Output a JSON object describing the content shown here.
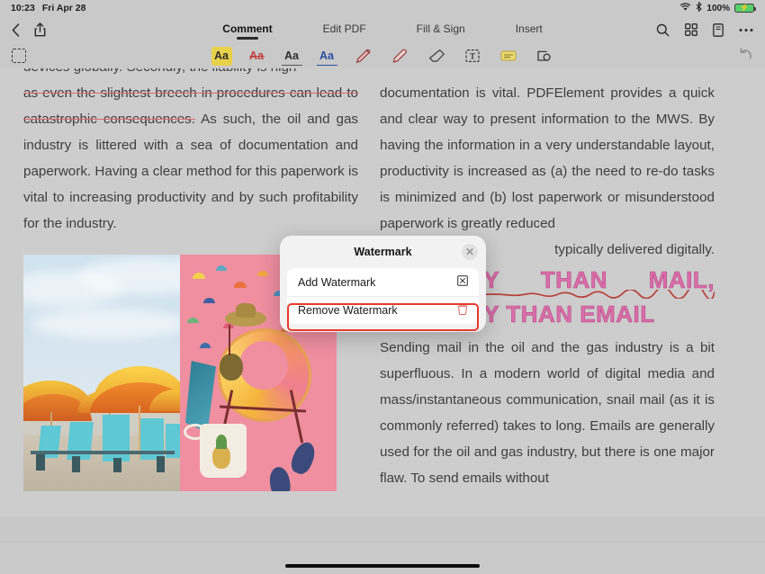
{
  "statusbar": {
    "time": "10:23",
    "date": "Fri Apr 28",
    "wifi_icon": "wifi-icon",
    "bluetooth_icon": "bluetooth-icon",
    "battery_percent": "100%",
    "battery_icon": "battery-charging-icon"
  },
  "navbar": {
    "back_icon": "chevron-left-icon",
    "share_icon": "share-icon",
    "tabs": [
      {
        "label": "Comment",
        "active": true
      },
      {
        "label": "Edit PDF",
        "active": false
      },
      {
        "label": "Fill & Sign",
        "active": false
      },
      {
        "label": "Insert",
        "active": false
      }
    ],
    "search_icon": "search-icon",
    "grid_icon": "grid-icon",
    "pages_icon": "page-thumbnail-icon",
    "more_icon": "more-ellipsis-icon"
  },
  "toolbar": {
    "select_tool": "marquee-select-icon",
    "tools": [
      {
        "name": "highlight-tool",
        "label": "Aa",
        "style": "hl-active"
      },
      {
        "name": "strikethrough-tool",
        "label": "Aa",
        "style": "strike"
      },
      {
        "name": "underline-tool",
        "label": "Aa",
        "style": "uline"
      },
      {
        "name": "squiggly-underline-tool",
        "label": "Aa",
        "style": "squig"
      },
      {
        "name": "pen-tool",
        "label": "✎",
        "style": "pen"
      },
      {
        "name": "marker-tool",
        "label": "✎",
        "style": "marker"
      },
      {
        "name": "eraser-tool",
        "label": "◇",
        "style": "eraser"
      },
      {
        "name": "text-box-tool",
        "label": "T",
        "style": "textbox"
      },
      {
        "name": "sticky-note-tool",
        "label": "▬",
        "style": "note"
      },
      {
        "name": "stamp-tool",
        "label": "◳",
        "style": "stamp"
      }
    ],
    "undo_icon": "undo-icon"
  },
  "document": {
    "left_column": {
      "line_cut": "devices globally. Secondly, the liability is high",
      "struck_text": "as even the slightest breech in procedures can lead to catastrophic consequences.",
      "rest": " As such, the oil and gas industry is littered with a sea of documentation and paperwork. Having a clear method for this paperwork is vital to increasing productivity and by such profitability for the industry.",
      "image_left_alt": "beach-umbrellas-photo",
      "image_right_alt": "pink-tropical-chair-photo"
    },
    "right_column": {
      "para1": "documentation is vital. PDFElement provides a quick and clear way to present information to the MWS. By having the information in a very understandable layout, productivity is increased as (a) the need to re-do tasks is minimized and (b) lost paperwork or misunderstood paperwork is greatly reduced",
      "para1_tail": "typically delivered digitally.",
      "watermark_line1_a": "DELIVERY",
      "watermark_line1_b": "THAN",
      "watermark_line1_c": "MAIL,",
      "watermark_line2": "DELIVERY THAN EMAIL",
      "para2_start": "Sending mail in the oil and the gas industry is a bit superfluous. In a modern world of digital media and mass/instantaneous communication, snail mail (as it is commonly referred) takes to long. Emails are generally used for the oil and gas industry, but there ",
      "para2_underlined": "is one major flaw.",
      "para2_end": " To send emails without"
    }
  },
  "dialog": {
    "title": "Watermark",
    "close_icon": "close-icon",
    "items": [
      {
        "label": "Add Watermark",
        "icon": "watermark-box-icon",
        "highlighted": false
      },
      {
        "label": "Remove Watermark",
        "icon": "trash-icon",
        "highlighted": true
      }
    ]
  },
  "colors": {
    "accent_highlight": "#e8d14a",
    "strike_red": "#e06868",
    "squiggly_blue": "#2b4fa0",
    "watermark_pink": "#d96fa8",
    "selection_red": "#e8392c",
    "battery_green": "#57d06a"
  },
  "bottom": {
    "home_indicator": "home-indicator"
  }
}
